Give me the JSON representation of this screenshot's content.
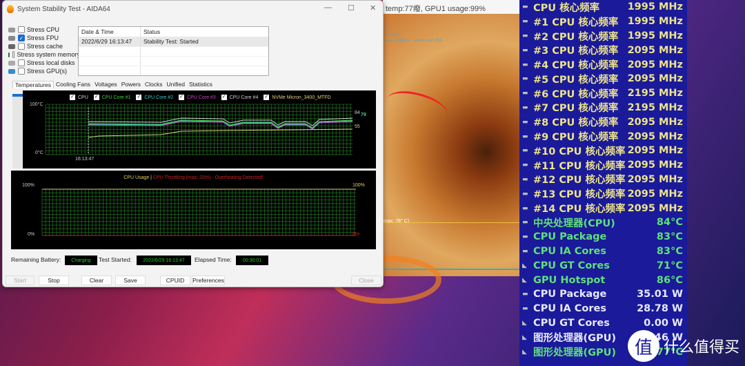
{
  "window": {
    "title": "System Stability Test - AIDA64",
    "controls": {
      "minimize": "—",
      "maximize": "☐",
      "close": "✕"
    }
  },
  "stress_options": [
    {
      "label": "Stress CPU",
      "checked": false,
      "icon": "cpu-icon"
    },
    {
      "label": "Stress FPU",
      "checked": true,
      "icon": "fpu-icon"
    },
    {
      "label": "Stress cache",
      "checked": false,
      "icon": "cache-icon"
    },
    {
      "label": "Stress system memory",
      "checked": false,
      "icon": "memory-icon"
    },
    {
      "label": "Stress local disks",
      "checked": false,
      "icon": "disk-icon"
    },
    {
      "label": "Stress GPU(s)",
      "checked": false,
      "icon": "gpu-icon"
    }
  ],
  "log": {
    "headers": [
      "Date & Time",
      "Status"
    ],
    "rows": [
      [
        "2022/6/29 16:13:47",
        "Stability Test: Started"
      ]
    ]
  },
  "tabs": [
    "Temperatures",
    "Cooling Fans",
    "Voltages",
    "Powers",
    "Clocks",
    "Unified",
    "Statistics"
  ],
  "active_tab": "Temperatures",
  "temp_chart": {
    "legend": [
      {
        "label": "CPU",
        "color": "#d0d0d0"
      },
      {
        "label": "CPU Core #1",
        "color": "#40d040"
      },
      {
        "label": "CPU Core #2",
        "color": "#40c8c8"
      },
      {
        "label": "CPU Core #3",
        "color": "#d040d0"
      },
      {
        "label": "CPU Core #4",
        "color": "#d0d0d0"
      },
      {
        "label": "NVMe Micron_3400_MTFD",
        "color": "#e0d080"
      }
    ],
    "y_top": "100°C",
    "y_bottom": "0°C",
    "x_label": "16:13:47",
    "end_values": [
      "84",
      "79",
      "55"
    ]
  },
  "usage_chart": {
    "title_usage": "CPU Usage",
    "separator": "|",
    "title_throttle": "CPU Throttling (max: 33%) - Overheating Detected!",
    "left_top": "100%",
    "left_bottom": "0%",
    "right_top": "100%",
    "right_bottom": "0%"
  },
  "status": {
    "battery_label": "Remaining Battery:",
    "battery_value": "Charging",
    "started_label": "Test Started:",
    "started_value": "2022/6/29 16:13:47",
    "elapsed_label": "Elapsed Time:",
    "elapsed_value": "00:30:01"
  },
  "buttons": {
    "start": "Start",
    "stop": "Stop",
    "clear": "Clear",
    "save": "Save",
    "cpuid": "CPUID",
    "preferences": "Preferences",
    "close": "Close"
  },
  "background": {
    "top_bar_text": "temp:77癈, GPU1 usage:99%",
    "cyan_lines": [
      "0",
      "Clk:5553",
      "mem: 5588MHz ... temp:0, vid:0, 0(0)"
    ],
    "max_label": "max: 78° C)"
  },
  "osd": {
    "rows": [
      {
        "label": "CPU 核心频率",
        "value": "1995 MHz",
        "color": "yellow",
        "icon": "cpu-icon"
      },
      {
        "label": "#1 CPU 核心频率",
        "value": "1995 MHz",
        "color": "yellow",
        "icon": "cpu-icon"
      },
      {
        "label": "#2 CPU 核心频率",
        "value": "1995 MHz",
        "color": "yellow",
        "icon": "cpu-icon"
      },
      {
        "label": "#3 CPU 核心频率",
        "value": "2095 MHz",
        "color": "yellow",
        "icon": "cpu-icon"
      },
      {
        "label": "#4 CPU 核心频率",
        "value": "2095 MHz",
        "color": "yellow",
        "icon": "cpu-icon"
      },
      {
        "label": "#5 CPU 核心频率",
        "value": "2095 MHz",
        "color": "yellow",
        "icon": "cpu-icon"
      },
      {
        "label": "#6 CPU 核心频率",
        "value": "2195 MHz",
        "color": "yellow",
        "icon": "cpu-icon"
      },
      {
        "label": "#7 CPU 核心频率",
        "value": "2195 MHz",
        "color": "yellow",
        "icon": "cpu-icon"
      },
      {
        "label": "#8 CPU 核心频率",
        "value": "2095 MHz",
        "color": "yellow",
        "icon": "cpu-icon"
      },
      {
        "label": "#9 CPU 核心频率",
        "value": "2095 MHz",
        "color": "yellow",
        "icon": "cpu-icon"
      },
      {
        "label": "#10 CPU 核心频率",
        "value": "2095 MHz",
        "color": "yellow",
        "icon": "cpu-icon"
      },
      {
        "label": "#11 CPU 核心频率",
        "value": "2095 MHz",
        "color": "yellow",
        "icon": "cpu-icon"
      },
      {
        "label": "#12 CPU 核心频率",
        "value": "2095 MHz",
        "color": "yellow",
        "icon": "cpu-icon"
      },
      {
        "label": "#13 CPU 核心频率",
        "value": "2095 MHz",
        "color": "yellow",
        "icon": "cpu-icon"
      },
      {
        "label": "#14 CPU 核心频率",
        "value": "2095 MHz",
        "color": "yellow",
        "icon": "cpu-icon"
      },
      {
        "label": "中央处理器(CPU)",
        "value": "84°C",
        "color": "green",
        "icon": "cpu-icon"
      },
      {
        "label": "CPU Package",
        "value": "83°C",
        "color": "green",
        "icon": "cpu-icon"
      },
      {
        "label": "CPU IA Cores",
        "value": "83°C",
        "color": "green",
        "icon": "cpu-icon"
      },
      {
        "label": "CPU GT Cores",
        "value": "71°C",
        "color": "green",
        "icon": "gpu-icon"
      },
      {
        "label": "GPU Hotspot",
        "value": "86°C",
        "color": "green",
        "icon": "gpu-icon"
      },
      {
        "label": "CPU Package",
        "value": "35.01 W",
        "color": "white",
        "icon": "cpu-icon"
      },
      {
        "label": "CPU IA Cores",
        "value": "28.78 W",
        "color": "white",
        "icon": "cpu-icon"
      },
      {
        "label": "CPU GT Cores",
        "value": "0.00 W",
        "color": "white",
        "icon": "gpu-icon"
      },
      {
        "label": "图形处理器(GPU)",
        "value": "0.46 W",
        "color": "white",
        "icon": "gpu-icon"
      },
      {
        "label": "图形处理器(GPU)",
        "value": "77°C",
        "color": "green",
        "icon": "gpu-icon"
      }
    ]
  },
  "watermark": {
    "badge": "值",
    "text": "什么值得买"
  }
}
